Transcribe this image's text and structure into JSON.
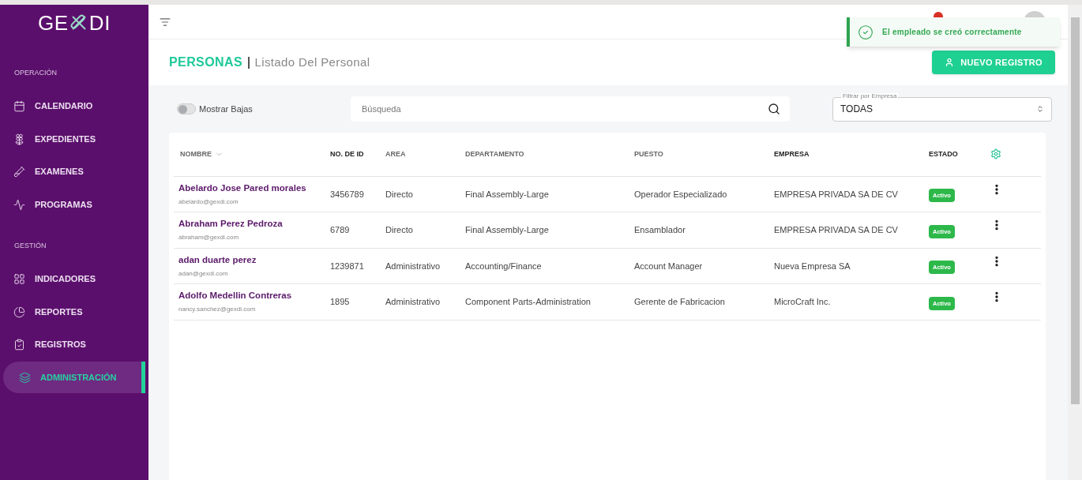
{
  "logo": "GE",
  "logo_tail": "DI",
  "sidebar": {
    "sections": [
      {
        "title": "OPERACIÓN",
        "items": [
          {
            "label": "CALENDARIO",
            "selected": false
          },
          {
            "label": "EXPEDIENTES",
            "selected": false
          },
          {
            "label": "EXAMENES",
            "selected": false
          },
          {
            "label": "PROGRAMAS",
            "selected": false
          }
        ]
      },
      {
        "title": "GESTIÓN",
        "items": [
          {
            "label": "INDICADORES",
            "selected": false
          },
          {
            "label": "REPORTES",
            "selected": false
          },
          {
            "label": "REGISTROS",
            "selected": false
          },
          {
            "label": "ADMINISTRACIÓN",
            "selected": true
          }
        ]
      }
    ]
  },
  "toast": {
    "message": "El empleado se creó correctamente"
  },
  "page": {
    "title": "PERSONAS",
    "subtitle": "Listado Del Personal",
    "new_button": "NUEVO REGISTRO"
  },
  "filters": {
    "show_inactive": {
      "label": "Mostrar Bajas",
      "on": false
    },
    "search": {
      "placeholder": "Búsqueda"
    },
    "company": {
      "label": "Filtrar por Empresa",
      "value": "TODAS"
    }
  },
  "table": {
    "columns": [
      "NOMBRE",
      "NO. DE ID",
      "AREA",
      "DEPARTAMENTO",
      "PUESTO",
      "EMPRESA",
      "ESTADO"
    ],
    "rows": [
      {
        "name": "Abelardo Jose Pared morales",
        "email": "abelardo@gexdi.com",
        "id": "3456789",
        "area": "Directo",
        "department": "Final Assembly-Large",
        "position": "Operador Especializado",
        "company": "EMPRESA PRIVADA SA DE CV",
        "status": "Activo"
      },
      {
        "name": "Abraham Perez Pedroza",
        "email": "abraham@gexdi.com",
        "id": "6789",
        "area": "Directo",
        "department": "Final Assembly-Large",
        "position": "Ensamblador",
        "company": "EMPRESA PRIVADA SA DE CV",
        "status": "Activo"
      },
      {
        "name": "adan duarte perez",
        "email": "adan@gexdi.com",
        "id": "1239871",
        "area": "Administrativo",
        "department": "Accounting/Finance",
        "position": "Account Manager",
        "company": "Nueva Empresa SA",
        "status": "Activo"
      },
      {
        "name": "Adolfo Medellin Contreras",
        "email": "nancy.sanchez@gexdi.com",
        "id": "1895",
        "area": "Administrativo",
        "department": "Component Parts-Administration",
        "position": "Gerente de Fabricacion",
        "company": "MicroCraft Inc.",
        "status": "Activo"
      }
    ]
  }
}
